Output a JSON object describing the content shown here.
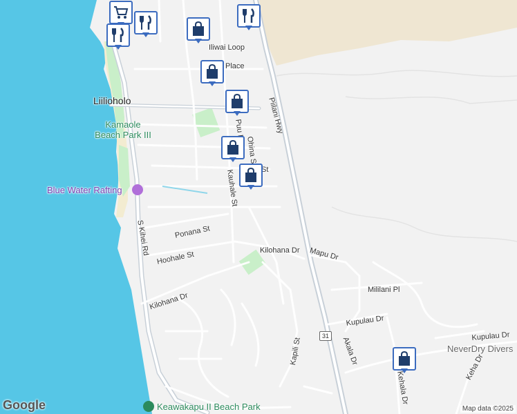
{
  "map": {
    "place_labels": {
      "liiliholo": "Liilioholo"
    },
    "parks": {
      "kamaole": "Kamaole\nBeach Park III",
      "keawakapu": "Keawakapu II Beach Park"
    },
    "pois": {
      "blue_water": "Blue Water Rafting",
      "neverdry": "NeverDry Divers"
    },
    "streets": {
      "iliwai": "Iliwai Loop",
      "place": "Place",
      "piilani": "Piilani Hwy",
      "puu": "Puu I",
      "ohina": "Ohina St",
      "kauhale": "Kauhale St",
      "ohina_st2": "St",
      "kihei": "S Kihei Rd",
      "ponana": "Ponana St",
      "hoohale": "Hoohale St",
      "kilohana1": "Kilohana Dr",
      "kilohana2": "Kilohana Dr",
      "mapu": "Mapu Dr",
      "mililani": "Mililani Pl",
      "kupulau1": "Kupulau Dr",
      "kupulau2": "Kupulau Dr",
      "akala": "Akala Dr",
      "kapili": "Kapili St",
      "kehala": "Kehala Dr",
      "keha": "Keha Dr"
    },
    "route_shield": "31",
    "logo": "Google",
    "attribution": "Map data ©2025",
    "markers": [
      {
        "icon": "shopping-cart-icon"
      },
      {
        "icon": "restaurant-icon"
      },
      {
        "icon": "restaurant-icon"
      },
      {
        "icon": "restaurant-icon"
      },
      {
        "icon": "shopping-bag-icon"
      },
      {
        "icon": "shopping-bag-icon"
      },
      {
        "icon": "shopping-bag-icon"
      },
      {
        "icon": "shopping-bag-icon"
      },
      {
        "icon": "shopping-bag-icon"
      },
      {
        "icon": "shopping-bag-icon"
      }
    ],
    "colors": {
      "ocean": "#56c6e6",
      "land": "#f2f2f2",
      "highway": "#c8d0d8",
      "park": "#c9efc9",
      "beach": "#f3ecd1",
      "marker_border": "#3b6bbf",
      "marker_icon": "#1f3d6b"
    }
  }
}
